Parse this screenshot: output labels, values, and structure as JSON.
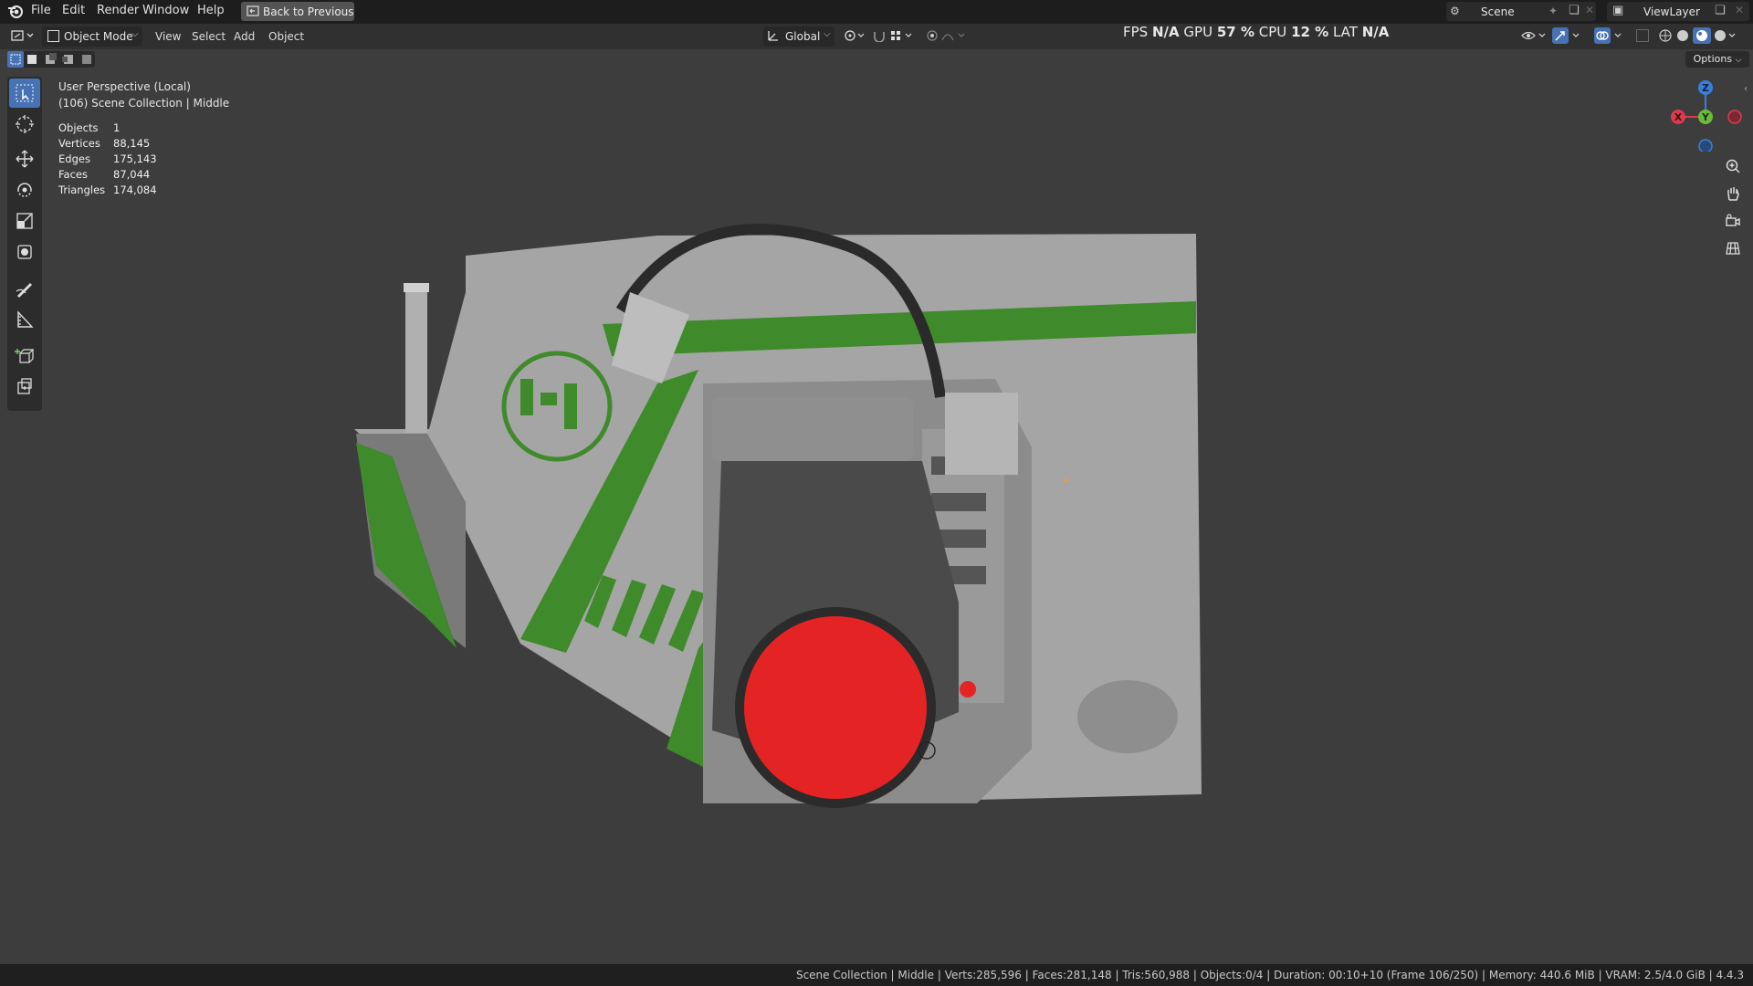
{
  "menu": {
    "file": "File",
    "edit": "Edit",
    "render": "Render",
    "window": "Window",
    "help": "Help",
    "back": "Back to Previous"
  },
  "topright": {
    "scene": "Scene",
    "view_layer": "ViewLayer"
  },
  "header": {
    "mode": "Object Mode",
    "view": "View",
    "select": "Select",
    "add": "Add",
    "object": "Object",
    "orientation": "Global"
  },
  "perf": {
    "fps_label": "FPS",
    "fps": "N/A",
    "gpu_label": "GPU",
    "gpu": "57 %",
    "cpu_label": "CPU",
    "cpu": "12 %",
    "lat_label": "LAT",
    "lat": "N/A"
  },
  "options": "Options",
  "overlay": {
    "perspective": "User Perspective (Local)",
    "collection": "(106) Scene Collection | Middle",
    "stats": [
      {
        "label": "Objects",
        "value": "1"
      },
      {
        "label": "Vertices",
        "value": "88,145"
      },
      {
        "label": "Edges",
        "value": "175,143"
      },
      {
        "label": "Faces",
        "value": "87,044"
      },
      {
        "label": "Triangles",
        "value": "174,084"
      }
    ]
  },
  "gizmo": {
    "x": "X",
    "y": "Y",
    "z": "Z"
  },
  "status": "Scene Collection | Middle | Verts:285,596 | Faces:281,148 | Tris:560,988 | Objects:0/4 | Duration: 00:10+10 (Frame 106/250) | Memory: 440.6 MiB | VRAM: 2.5/4.0 GiB | 4.4.3",
  "colors": {
    "accent": "#4772b3",
    "model_green": "#3f8a2a",
    "lens_red": "#e42424"
  }
}
